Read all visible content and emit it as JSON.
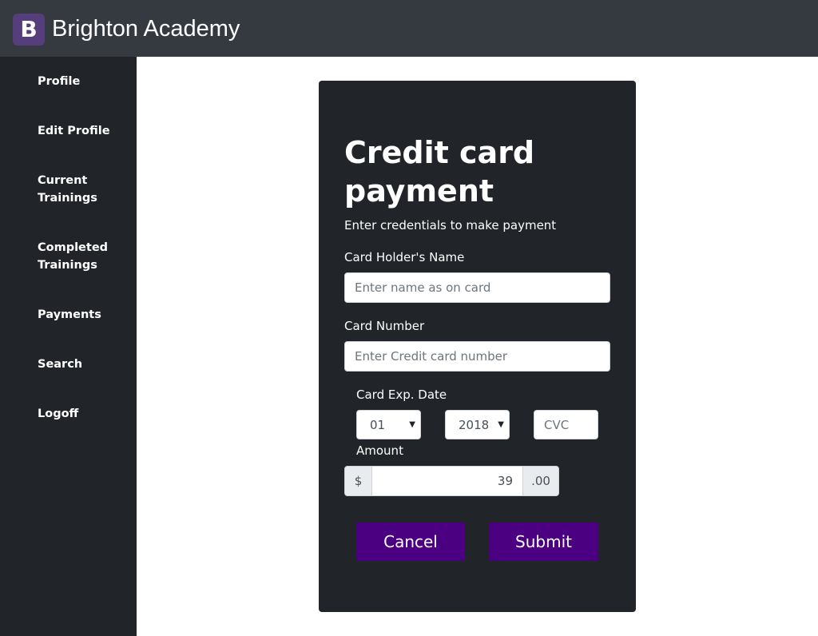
{
  "header": {
    "logo_letter": "B",
    "brand": "Brighton Academy"
  },
  "sidebar": {
    "items": [
      {
        "label": "Profile"
      },
      {
        "label": "Edit Profile"
      },
      {
        "label": "Current Trainings"
      },
      {
        "label": "Completed Trainings"
      },
      {
        "label": "Payments"
      },
      {
        "label": "Search"
      },
      {
        "label": "Logoff"
      }
    ]
  },
  "payment": {
    "title": "Credit card payment",
    "subtitle": "Enter credentials to make payment",
    "holder_label": "Card Holder's Name",
    "holder_placeholder": "Enter name as on card",
    "number_label": "Card Number",
    "number_placeholder": "Enter Credit card number",
    "exp_label": "Card Exp. Date",
    "exp_month": "01",
    "exp_year": "2018",
    "cvc_placeholder": "CVC",
    "amount_label": "Amount",
    "currency_symbol": "$",
    "amount_value": "39",
    "cents_suffix": ".00",
    "cancel_label": "Cancel",
    "submit_label": "Submit"
  },
  "colors": {
    "topbar": "#343a40",
    "sidebar": "#212529",
    "card": "#212529",
    "button": "#4b0082",
    "logo": "#563d7c"
  }
}
